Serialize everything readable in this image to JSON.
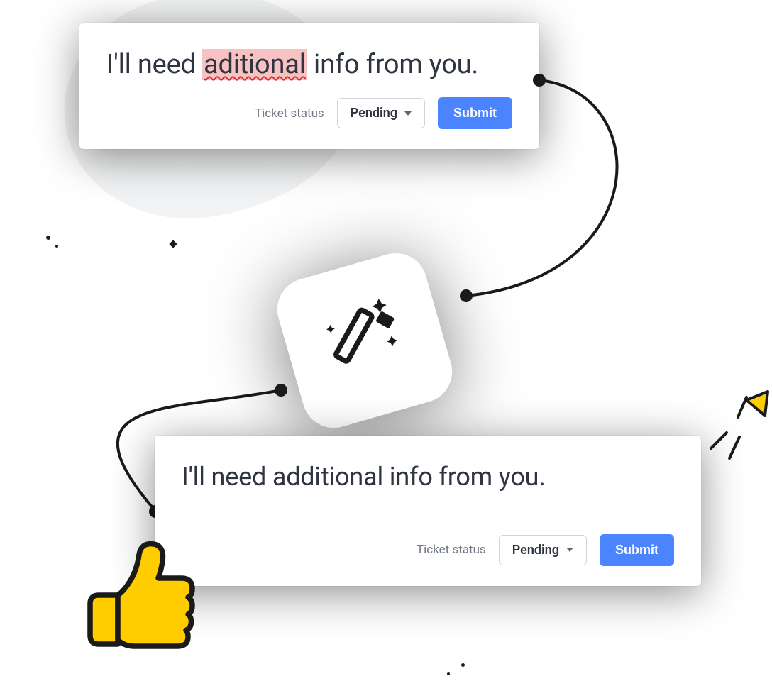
{
  "cards": {
    "before": {
      "text_prefix": "I'll need ",
      "misspelled": "aditional",
      "text_suffix": " info from you."
    },
    "after": {
      "text": "I'll need additional info from you."
    }
  },
  "controls": {
    "status_label": "Ticket status",
    "status_value": "Pending",
    "submit_label": "Submit"
  },
  "icons": {
    "wand": "magic-wand-icon",
    "thumb": "thumbs-up-icon",
    "spark": "spark-lines-icon"
  },
  "colors": {
    "primary": "#4a84ff",
    "error_highlight": "#f9c2c2",
    "error_underline": "#d92b2b",
    "text": "#2f3441",
    "muted": "#707683",
    "accent_yellow": "#ffcc00"
  }
}
